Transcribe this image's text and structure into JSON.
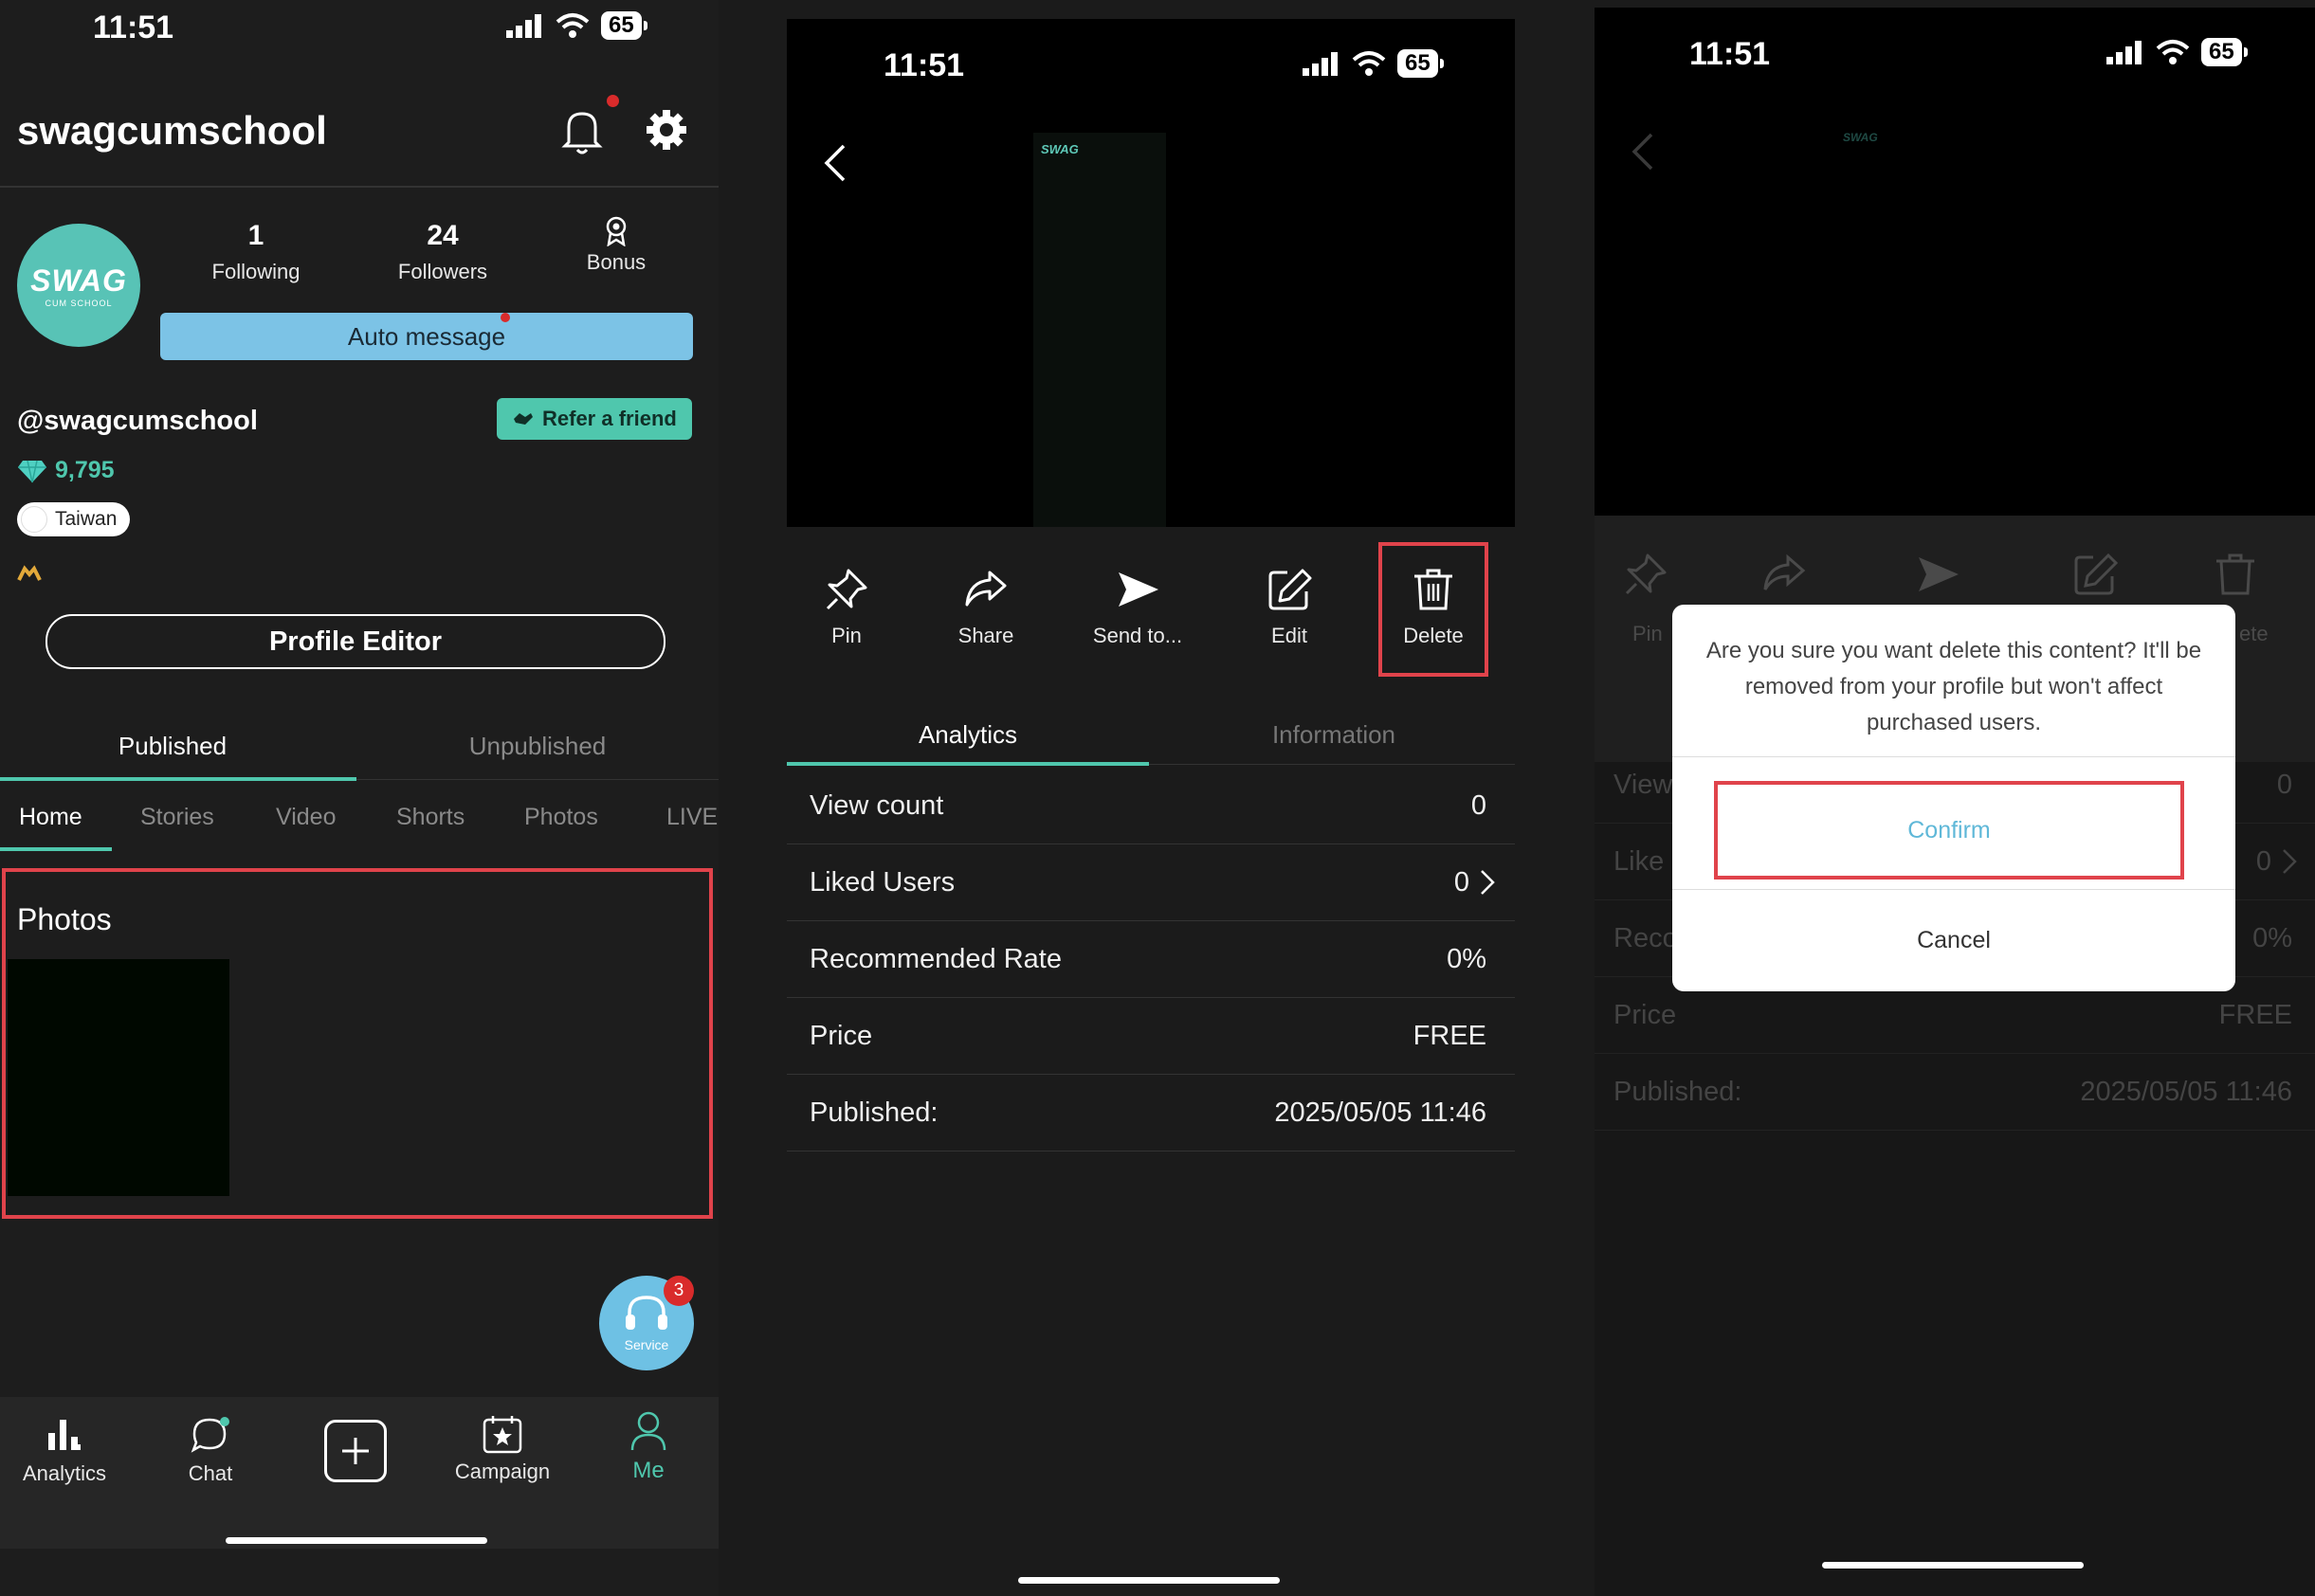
{
  "status": {
    "time": "11:51",
    "battery": "65"
  },
  "profile_screen": {
    "username_title": "swagcumschool",
    "avatar_text": {
      "line1": "SWAG",
      "line2": "CUM SCHOOL"
    },
    "stats": [
      {
        "value": "1",
        "label": "Following"
      },
      {
        "value": "24",
        "label": "Followers"
      },
      {
        "value": "",
        "label": "Bonus"
      }
    ],
    "auto_message": "Auto message",
    "handle": "@swagcumschool",
    "refer_button": "Refer a friend",
    "diamonds": "9,795",
    "location_tag": "Taiwan",
    "profile_editor_button": "Profile Editor",
    "content_tabs": [
      "Published",
      "Unpublished"
    ],
    "sub_tabs": [
      "Home",
      "Stories",
      "Video",
      "Shorts",
      "Photos",
      "LIVE"
    ],
    "photos_section_title": "Photos",
    "service_label": "Service",
    "service_badge": "3",
    "bottom_nav": [
      {
        "label": "Analytics",
        "icon": "bar-chart-icon"
      },
      {
        "label": "Chat",
        "icon": "chat-bubble-icon"
      },
      {
        "label": "",
        "icon": "add-square-icon"
      },
      {
        "label": "Campaign",
        "icon": "calendar-star-icon"
      },
      {
        "label": "Me",
        "icon": "person-icon"
      }
    ],
    "colors": {
      "accent": "#4fc7ad",
      "auto_message_bg": "#7cc3e6",
      "highlight_box": "#e0434b",
      "badge": "#d92b2b"
    }
  },
  "content_detail_screen": {
    "watermark": "SWAG",
    "actions": [
      {
        "label": "Pin",
        "icon": "pin-icon"
      },
      {
        "label": "Share",
        "icon": "share-arrow-icon"
      },
      {
        "label": "Send to...",
        "icon": "send-icon"
      },
      {
        "label": "Edit",
        "icon": "edit-icon"
      },
      {
        "label": "Delete",
        "icon": "trash-icon"
      }
    ],
    "tabs": [
      "Analytics",
      "Information"
    ],
    "rows": [
      {
        "label": "View count",
        "value": "0"
      },
      {
        "label": "Liked Users",
        "value": "0"
      },
      {
        "label": "Recommended Rate",
        "value": "0%"
      },
      {
        "label": "Price",
        "value": "FREE"
      },
      {
        "label": "Published:",
        "value": "2025/05/05 11:46"
      }
    ]
  },
  "confirm_screen": {
    "background_rows": [
      {
        "label": "View",
        "value": "0"
      },
      {
        "label": "Like",
        "value": "0"
      },
      {
        "label": "Reco",
        "value": "0%"
      },
      {
        "label": "Price",
        "value": "FREE"
      },
      {
        "label": "Published:",
        "value": "2025/05/05 11:46"
      }
    ],
    "background_actions": {
      "first": "Pin",
      "last": "ete"
    },
    "dialog_message": "Are you sure you want delete this content? It'll be removed from your profile but won't affect purchased users.",
    "confirm_button": "Confirm",
    "cancel_button": "Cancel",
    "colors": {
      "confirm_text": "#5fb8d8"
    }
  }
}
